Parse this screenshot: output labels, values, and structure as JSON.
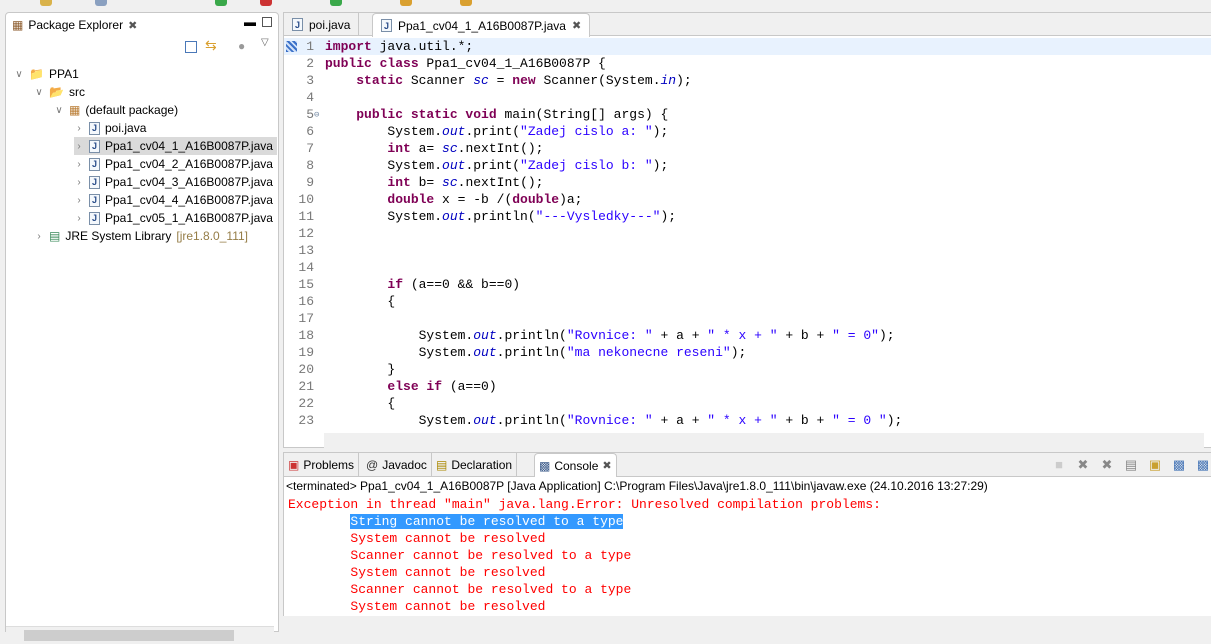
{
  "package_explorer": {
    "title": "Package Explorer",
    "tree": [
      {
        "label": "PPA1",
        "icon": "project-icon",
        "level": 0,
        "expanded": true
      },
      {
        "label": "src",
        "icon": "source-folder-icon",
        "level": 1,
        "expanded": true
      },
      {
        "label": "(default package)",
        "icon": "package-icon",
        "level": 2,
        "expanded": true
      },
      {
        "label": "poi.java",
        "icon": "java-file-icon",
        "level": 3
      },
      {
        "label": "Ppa1_cv04_1_A16B0087P.java",
        "icon": "java-file-icon",
        "level": 3,
        "selected": true
      },
      {
        "label": "Ppa1_cv04_2_A16B0087P.java",
        "icon": "java-file-icon",
        "level": 3
      },
      {
        "label": "Ppa1_cv04_3_A16B0087P.java",
        "icon": "java-file-icon",
        "level": 3
      },
      {
        "label": "Ppa1_cv04_4_A16B0087P.java",
        "icon": "java-file-icon",
        "level": 3
      },
      {
        "label": "Ppa1_cv05_1_A16B0087P.java",
        "icon": "java-file-icon",
        "level": 3
      },
      {
        "label": "JRE System Library",
        "suffix": "[jre1.8.0_111]",
        "icon": "library-icon",
        "level": 1
      }
    ]
  },
  "editor": {
    "tabs": [
      {
        "label": "poi.java"
      },
      {
        "label": "Ppa1_cv04_1_A16B0087P.java",
        "active": true
      }
    ],
    "lines": [
      [
        [
          "kw",
          "import"
        ],
        [
          "p",
          " java.util.*;"
        ]
      ],
      [
        [
          "kw",
          "public class"
        ],
        [
          "p",
          " Ppa1_cv04_1_A16B0087P {"
        ]
      ],
      [
        [
          "p",
          "    "
        ],
        [
          "kw",
          "static"
        ],
        [
          "p",
          " Scanner "
        ],
        [
          "fld",
          "sc"
        ],
        [
          "p",
          " = "
        ],
        [
          "kw",
          "new"
        ],
        [
          "p",
          " Scanner(System."
        ],
        [
          "fld",
          "in"
        ],
        [
          "p",
          ");"
        ]
      ],
      [],
      [
        [
          "p",
          "    "
        ],
        [
          "kw",
          "public static void"
        ],
        [
          "p",
          " main(String[] args) {"
        ]
      ],
      [
        [
          "p",
          "        System."
        ],
        [
          "fld",
          "out"
        ],
        [
          "p",
          ".print("
        ],
        [
          "str",
          "\"Zadej cislo a: \""
        ],
        [
          "p",
          ");"
        ]
      ],
      [
        [
          "p",
          "        "
        ],
        [
          "kw",
          "int"
        ],
        [
          "p",
          " a= "
        ],
        [
          "fld",
          "sc"
        ],
        [
          "p",
          ".nextInt();"
        ]
      ],
      [
        [
          "p",
          "        System."
        ],
        [
          "fld",
          "out"
        ],
        [
          "p",
          ".print("
        ],
        [
          "str",
          "\"Zadej cislo b: \""
        ],
        [
          "p",
          ");"
        ]
      ],
      [
        [
          "p",
          "        "
        ],
        [
          "kw",
          "int"
        ],
        [
          "p",
          " b= "
        ],
        [
          "fld",
          "sc"
        ],
        [
          "p",
          ".nextInt();"
        ]
      ],
      [
        [
          "p",
          "        "
        ],
        [
          "kw",
          "double"
        ],
        [
          "p",
          " x = -b /("
        ],
        [
          "kw",
          "double"
        ],
        [
          "p",
          ")a;"
        ]
      ],
      [
        [
          "p",
          "        System."
        ],
        [
          "fld",
          "out"
        ],
        [
          "p",
          ".println("
        ],
        [
          "str",
          "\"---Vysledky---\""
        ],
        [
          "p",
          ");"
        ]
      ],
      [],
      [],
      [],
      [
        [
          "p",
          "        "
        ],
        [
          "kw",
          "if"
        ],
        [
          "p",
          " (a==0 && b==0)"
        ]
      ],
      [
        [
          "p",
          "        {"
        ]
      ],
      [],
      [
        [
          "p",
          "            System."
        ],
        [
          "fld",
          "out"
        ],
        [
          "p",
          ".println("
        ],
        [
          "str",
          "\"Rovnice: \""
        ],
        [
          "p",
          " + a + "
        ],
        [
          "str",
          "\" * x + \""
        ],
        [
          "p",
          " + b + "
        ],
        [
          "str",
          "\" = 0\""
        ],
        [
          "p",
          ");"
        ]
      ],
      [
        [
          "p",
          "            System."
        ],
        [
          "fld",
          "out"
        ],
        [
          "p",
          ".println("
        ],
        [
          "str",
          "\"ma nekonecne reseni\""
        ],
        [
          "p",
          ");"
        ]
      ],
      [
        [
          "p",
          "        }"
        ]
      ],
      [
        [
          "p",
          "        "
        ],
        [
          "kw",
          "else if"
        ],
        [
          "p",
          " (a==0)"
        ]
      ],
      [
        [
          "p",
          "        {"
        ]
      ],
      [
        [
          "p",
          "            System."
        ],
        [
          "fld",
          "out"
        ],
        [
          "p",
          ".println("
        ],
        [
          "str",
          "\"Rovnice: \""
        ],
        [
          "p",
          " + a + "
        ],
        [
          "str",
          "\" * x + \""
        ],
        [
          "p",
          " + b + "
        ],
        [
          "str",
          "\" = 0 \""
        ],
        [
          "p",
          ");"
        ]
      ]
    ]
  },
  "console": {
    "tabs": [
      {
        "label": "Problems",
        "icon": "problems-icon"
      },
      {
        "label": "Javadoc",
        "icon": "at-icon"
      },
      {
        "label": "Declaration",
        "icon": "declaration-icon"
      },
      {
        "label": "Console",
        "icon": "console-icon",
        "active": true
      }
    ],
    "description": "<terminated> Ppa1_cv04_1_A16B0087P [Java Application] C:\\Program Files\\Java\\jre1.8.0_111\\bin\\javaw.exe (24.10.2016 13:27:29)",
    "output": [
      {
        "text": "Exception in thread \"main\" java.lang.Error: Unresolved compilation problems: "
      },
      {
        "indent": "        ",
        "text": "String cannot be resolved to a type",
        "selected": true
      },
      {
        "indent": "        ",
        "text": "System cannot be resolved"
      },
      {
        "indent": "        ",
        "text": "Scanner cannot be resolved to a type"
      },
      {
        "indent": "        ",
        "text": "System cannot be resolved"
      },
      {
        "indent": "        ",
        "text": "Scanner cannot be resolved to a type"
      },
      {
        "indent": "        ",
        "text": "System cannot be resolved"
      }
    ]
  },
  "colors": {
    "keyword": "#7f0055",
    "string": "#2a00ff",
    "field": "#0000c0",
    "error": "#ff0000",
    "selection": "#3399ff"
  }
}
